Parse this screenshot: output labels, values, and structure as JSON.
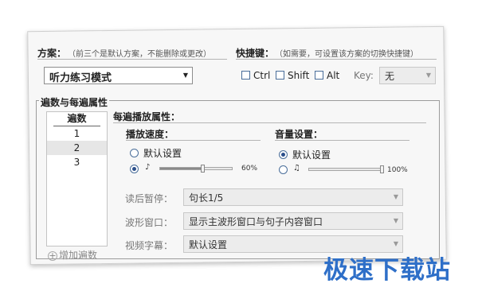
{
  "scheme": {
    "label": "方案：",
    "hint": "（前三个是默认方案，不能删除或更改）",
    "selected": "听力练习模式"
  },
  "hotkey": {
    "label": "快捷键：",
    "hint": "（如需要，可设置该方案的切换快捷键）",
    "ctrl": "Ctrl",
    "shift": "Shift",
    "alt": "Alt",
    "key_label": "Key:",
    "key_value": "无"
  },
  "group": {
    "title": "遍数与每遍属性",
    "list_header": "遍数",
    "rows": [
      "1",
      "2",
      "3"
    ],
    "add_label": "增加遍数"
  },
  "props": {
    "title": "每遍播放属性：",
    "speed": {
      "label": "播放速度：",
      "default_option": "默认设置",
      "value_text": "60%",
      "fraction": 0.6
    },
    "volume": {
      "label": "音量设置：",
      "default_option": "默认设置",
      "value_text": "100%",
      "fraction": 1.0
    },
    "pause_label": "读后暂停：",
    "pause_value": "句长1/5",
    "waveform_label": "波形窗口：",
    "waveform_value": "显示主波形窗口与句子内容窗口",
    "subtitle_label": "视频字幕：",
    "subtitle_value": "默认设置"
  },
  "watermark": "极速下载站",
  "colors": {
    "accent": "#2b4e8a",
    "watermark": "#2e6fc8"
  },
  "icons": [
    "volume-icon",
    "plus-icon",
    "dropdown-arrow-icon"
  ]
}
